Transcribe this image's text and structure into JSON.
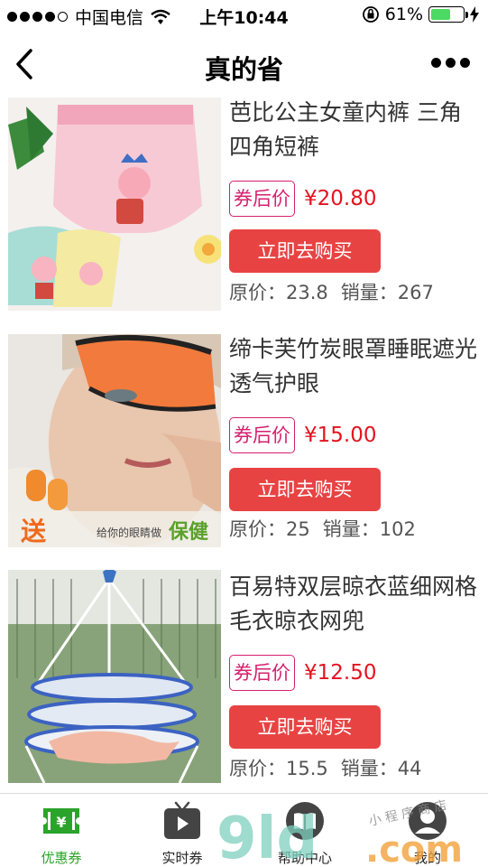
{
  "status_bar": {
    "carrier": "中国电信",
    "time": "上午10:44",
    "battery_percent_label": "61%",
    "battery_level": 0.61
  },
  "nav": {
    "title": "真的省"
  },
  "products": [
    {
      "title": "芭比公主女童内裤 三角四角短裤",
      "coupon_label": "券后价",
      "coupon_price": "¥20.80",
      "buy_label": "立即去购买",
      "original_price": "原价：23.8",
      "sales": "销量：267"
    },
    {
      "title": "缔卡芙竹炭眼罩睡眠遮光透气护眼",
      "coupon_label": "券后价",
      "coupon_price": "¥15.00",
      "buy_label": "立即去购买",
      "original_price": "原价：25",
      "sales": "销量：102",
      "image_text": {
        "gift": "送",
        "slogan": "给你的眼睛做",
        "highlight": "保健"
      }
    },
    {
      "title": "百易特双层晾衣蓝细网格毛衣晾衣网兜",
      "coupon_label": "券后价",
      "coupon_price": "¥12.50",
      "buy_label": "立即去购买",
      "original_price": "原价：15.5",
      "sales": "销量：44"
    }
  ],
  "tabs": [
    {
      "label": "优惠券",
      "icon": "coupon-icon",
      "active": true
    },
    {
      "label": "实时券",
      "icon": "play-icon",
      "active": false
    },
    {
      "label": "帮助中心",
      "icon": "book-icon",
      "active": false
    },
    {
      "label": "我的",
      "icon": "user-icon",
      "active": false
    }
  ],
  "watermark": {
    "brand": "9ld.com",
    "tagline": "小 程 序 商 店"
  },
  "colors": {
    "accent_red": "#e84343",
    "price_red": "#e3141f",
    "coupon_pink": "#d6206f",
    "tab_active_green": "#2aa42a"
  }
}
